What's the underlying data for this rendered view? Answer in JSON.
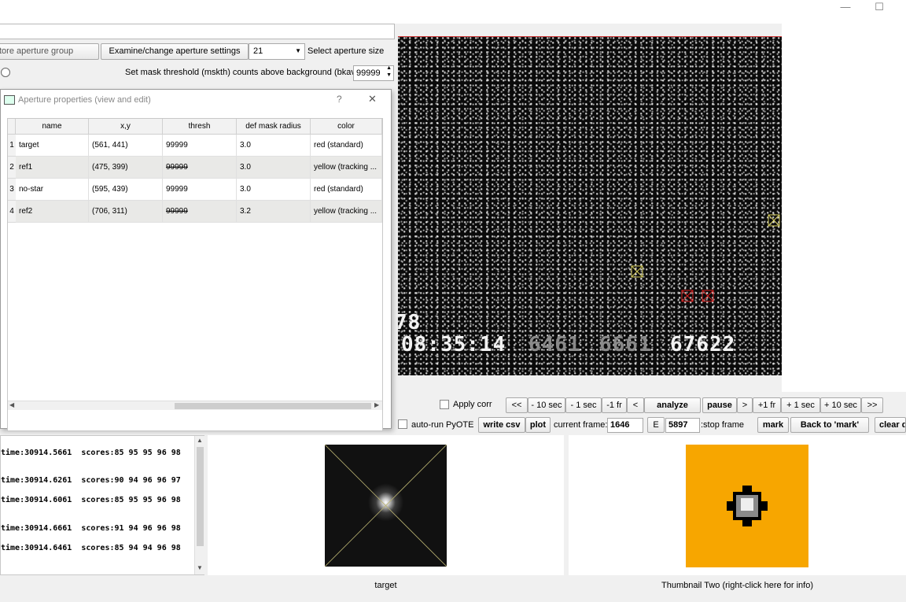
{
  "window": {
    "minimize_icon": "minimize-icon",
    "maximize_icon": "maximize-icon"
  },
  "top_controls": {
    "store_aperture_group_btn": "tore aperture group",
    "examine_settings_btn": "Examine/change aperture settings",
    "aperture_size_value": "21",
    "aperture_size_label": "Select aperture size",
    "mask_threshold_label": "Set mask threshold (mskth) counts above background (bkavg)",
    "mask_threshold_value": "99999"
  },
  "dialog": {
    "title": "Aperture properties (view and edit)",
    "help": "?",
    "close": "✕",
    "columns": [
      "name",
      "x,y",
      "thresh",
      "def mask radius",
      "color"
    ],
    "rows": [
      {
        "num": "1",
        "name": "target",
        "xy": "(561, 441)",
        "thresh": "99999",
        "radius": "3.0",
        "color": "red (standard)"
      },
      {
        "num": "2",
        "name": "ref1",
        "xy": "(475, 399)",
        "thresh": "99999",
        "radius": "3.0",
        "color": "yellow (tracking ..."
      },
      {
        "num": "3",
        "name": "no-star",
        "xy": "(595, 439)",
        "thresh": "99999",
        "radius": "3.0",
        "color": "red (standard)"
      },
      {
        "num": "4",
        "name": "ref2",
        "xy": "(706, 311)",
        "thresh": "99999",
        "radius": "3.2",
        "color": "yellow (tracking ..."
      }
    ]
  },
  "overlay": {
    "line1": "78",
    "time": "08:35:14",
    "v1": "6461",
    "v2": "6661",
    "v3": "67622"
  },
  "controls": {
    "apply_corr": "Apply corr",
    "nav_buttons": [
      "<<",
      "- 10 sec",
      "- 1 sec",
      "-1 fr",
      "<",
      "analyze",
      "pause",
      ">",
      "+1 fr",
      "+ 1 sec",
      "+ 10 sec",
      ">>"
    ],
    "auto_run": "auto-run PyOTE",
    "write_csv": "write csv",
    "plot": "plot",
    "current_frame_label": "current frame:",
    "current_frame": "1646",
    "e_btn": "E",
    "stop_frame": "5897",
    "stop_frame_label": ":stop frame",
    "mark": "mark",
    "back_to_mark": "Back to 'mark'",
    "clear": "clear d"
  },
  "log_lines": [
    "time:30914.5661  scores:85 95 95 96 98",
    "time:30914.6261  scores:90 94 96 96 97",
    "time:30914.6061  scores:85 95 95 96 98",
    "time:30914.6661  scores:91 94 96 96 98",
    "time:30914.6461  scores:85 94 94 96 98"
  ],
  "thumbnails": {
    "one_caption": "target",
    "two_caption": "Thumbnail Two (right-click here for info)"
  },
  "colors": {
    "thumb_two_bg": "#f7a600",
    "red_aperture": "#d42020",
    "yellow_aperture": "#d8d060"
  }
}
